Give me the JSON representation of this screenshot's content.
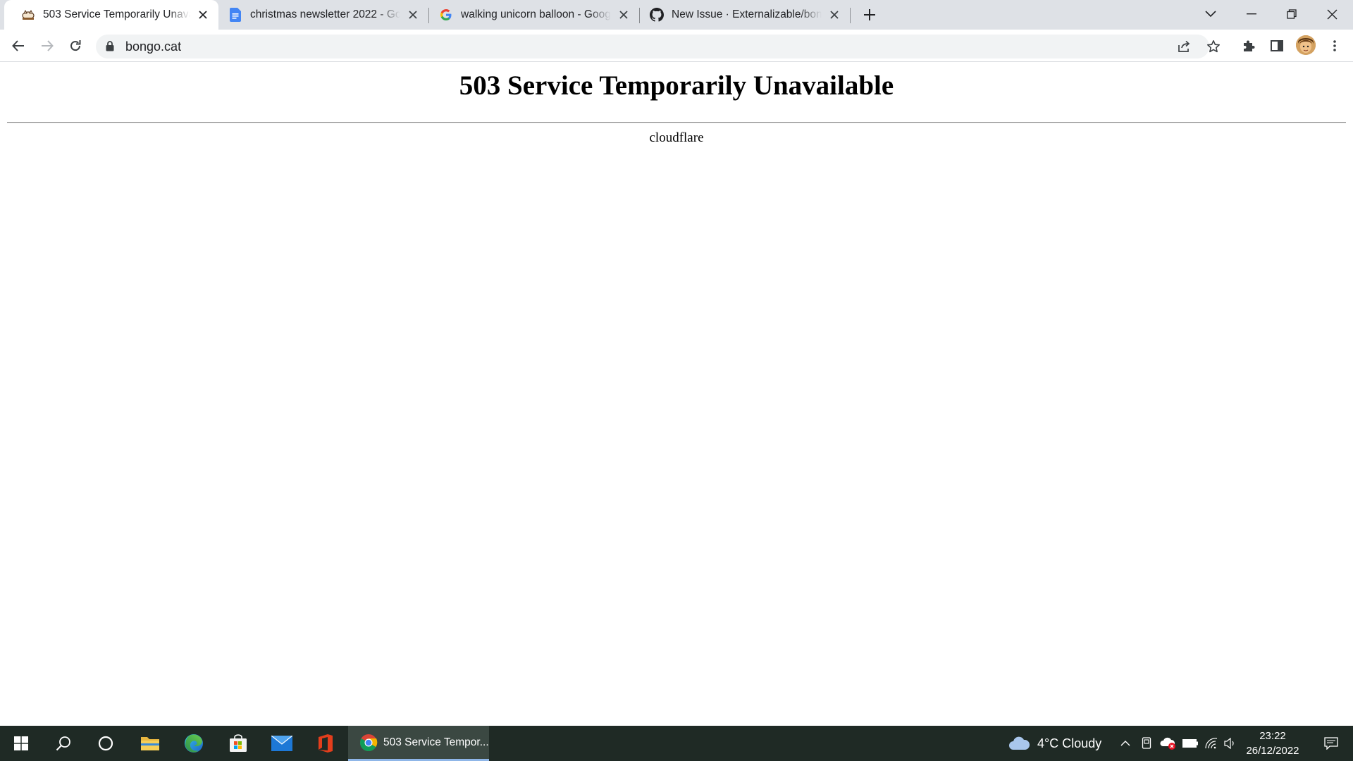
{
  "browser": {
    "tabs": [
      {
        "title": "503 Service Temporarily Unavailable",
        "active": true,
        "favicon": "bongo-cat-icon"
      },
      {
        "title": "christmas newsletter 2022 - Google Docs",
        "active": false,
        "favicon": "google-docs-icon"
      },
      {
        "title": "walking unicorn balloon - Google Search",
        "active": false,
        "favicon": "google-icon"
      },
      {
        "title": "New Issue · Externalizable/bongo.cat",
        "active": false,
        "favicon": "github-icon"
      }
    ],
    "url": "bongo.cat"
  },
  "page": {
    "heading": "503 Service Temporarily Unavailable",
    "server": "cloudflare"
  },
  "taskbar": {
    "active_app_label": "503 Service Tempor...",
    "weather": "4°C  Cloudy",
    "time": "23:22",
    "date": "26/12/2022"
  },
  "colors": {
    "tabstrip_bg": "#dee1e6",
    "omnibox_bg": "#f1f3f4",
    "taskbar_bg": "#1f2a25"
  }
}
